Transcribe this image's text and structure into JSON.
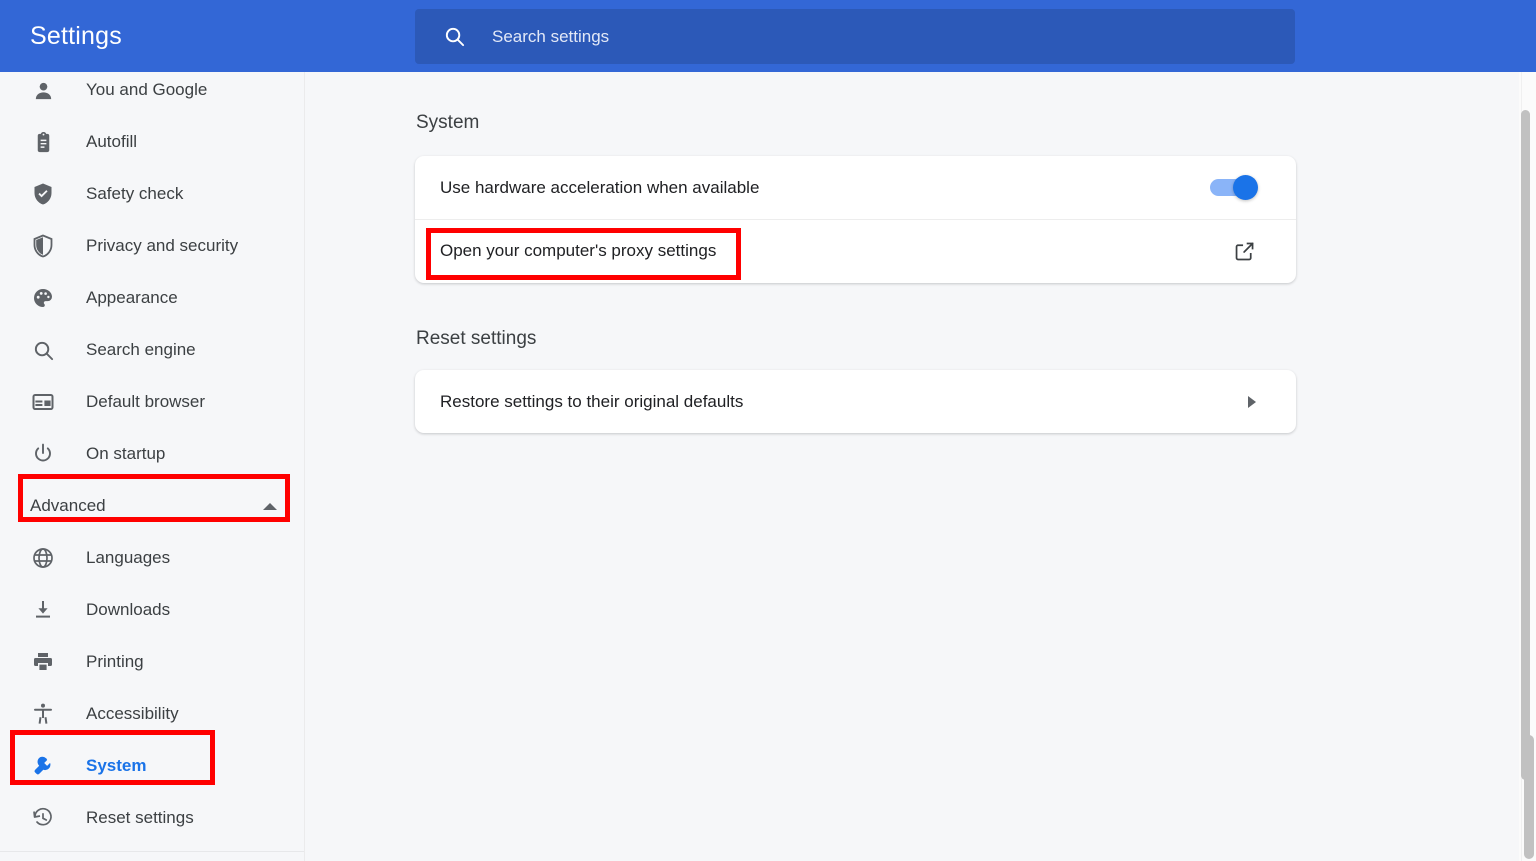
{
  "header": {
    "title": "Settings",
    "search_placeholder": "Search settings",
    "search_value": ""
  },
  "sidebar": {
    "items": [
      {
        "label": "You and Google",
        "icon": "person-icon",
        "selected": false,
        "partial": true
      },
      {
        "label": "Autofill",
        "icon": "clipboard-icon",
        "selected": false
      },
      {
        "label": "Safety check",
        "icon": "shield-check-icon",
        "selected": false
      },
      {
        "label": "Privacy and security",
        "icon": "shield-half-icon",
        "selected": false
      },
      {
        "label": "Appearance",
        "icon": "palette-icon",
        "selected": false
      },
      {
        "label": "Search engine",
        "icon": "search-icon",
        "selected": false
      },
      {
        "label": "Default browser",
        "icon": "browser-window-icon",
        "selected": false
      },
      {
        "label": "On startup",
        "icon": "power-icon",
        "selected": false
      }
    ],
    "advanced": {
      "label": "Advanced",
      "expanded": true,
      "chevron": "chevron-up-icon"
    },
    "advanced_items": [
      {
        "label": "Languages",
        "icon": "globe-icon",
        "selected": false
      },
      {
        "label": "Downloads",
        "icon": "download-icon",
        "selected": false
      },
      {
        "label": "Printing",
        "icon": "printer-icon",
        "selected": false
      },
      {
        "label": "Accessibility",
        "icon": "accessibility-icon",
        "selected": false
      },
      {
        "label": "System",
        "icon": "wrench-icon",
        "selected": true
      },
      {
        "label": "Reset settings",
        "icon": "history-restore-icon",
        "selected": false
      }
    ]
  },
  "main": {
    "system": {
      "title": "System",
      "hardware_acceleration": {
        "label": "Use hardware acceleration when available",
        "toggle_on": true
      },
      "proxy": {
        "label": "Open your computer's proxy settings",
        "icon": "external-link-icon"
      }
    },
    "reset": {
      "title": "Reset settings",
      "restore": {
        "label": "Restore settings to their original defaults",
        "icon": "chevron-right-icon"
      }
    }
  },
  "annotations": {
    "color": "#ff0000",
    "boxes": [
      "Advanced",
      "System",
      "Open your computer's proxy settings"
    ]
  },
  "colors": {
    "header_blue": "#3367d6",
    "search_blue": "#2c59b8",
    "accent_blue": "#1a73e8",
    "toggle_track": "#8ab4f8",
    "page_bg": "#f6f7f9",
    "card_bg": "#ffffff",
    "text_primary": "#202124",
    "text_secondary": "#3c4043",
    "icon_gray": "#5f6368"
  }
}
